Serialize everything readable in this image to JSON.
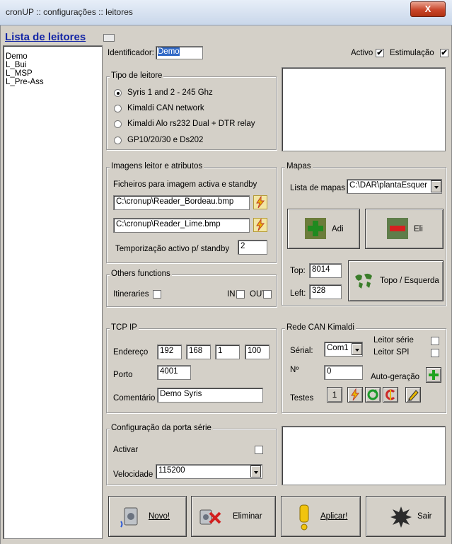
{
  "window": {
    "title": "cronUP :: configurações :: leitores",
    "close_label": "X"
  },
  "list": {
    "title": "Lista de leitores",
    "items": [
      "Demo",
      "L_Bui",
      "L_MSP",
      "L_Pre-Ass"
    ]
  },
  "identificador": {
    "label": "Identificador:",
    "value": "Demo"
  },
  "activo": {
    "label": "Activo",
    "checked": true
  },
  "estimulacao": {
    "label": "Estimulação",
    "checked": true
  },
  "tipo_leitor": {
    "title": "Tipo de leitore",
    "options": [
      "Syris 1 and 2 - 245 Ghz",
      "Kimaldi CAN network",
      "Kimaldi Alo rs232 Dual + DTR relay",
      "GP10/20/30 e Ds202"
    ],
    "selected_index": 0
  },
  "imagens": {
    "title": "Imagens leitor e atributos",
    "ficheiros_label": "Ficheiros para imagem activa e standby",
    "file_active": "C:\\cronup\\Reader_Bordeau.bmp",
    "file_standby": "C:\\cronup\\Reader_Lime.bmp",
    "temporizacao_label": "Temporização activo p/ standby",
    "temporizacao_value": "2"
  },
  "mapas": {
    "title": "Mapas",
    "lista_label": "Lista de mapas",
    "lista_value": "C:\\DAR\\plantaEsquer",
    "add_label": "Adi",
    "del_label": "Eli",
    "top_label": "Top:",
    "top_value": "8014",
    "left_label": "Left:",
    "left_value": "328",
    "topo_button": "Topo / Esquerda"
  },
  "others": {
    "title": "Others functions",
    "itineraries_label": "Itineraries",
    "in_label": "IN",
    "out_label": "OUT"
  },
  "tcpip": {
    "title": "TCP IP",
    "endereco_label": "Endereço",
    "ip": [
      "192",
      "168",
      "1",
      "100"
    ],
    "porto_label": "Porto",
    "porto_value": "4001",
    "comentario_label": "Comentário",
    "comentario_value": "Demo Syris"
  },
  "rede_can": {
    "title": "Rede CAN Kimaldi",
    "serial_label": "Sérial:",
    "serial_value": "Com1",
    "leitor_serie_label": "Leitor série",
    "leitor_spi_label": "Leitor SPI",
    "n_label": "Nº",
    "n_value": "0",
    "autogeracao_label": "Auto-geração",
    "testes_label": "Testes",
    "testes_number": "1"
  },
  "porta_serie": {
    "title": "Configuração da porta série",
    "activar_label": "Activar",
    "velocidade_label": "Velocidade",
    "velocidade_value": "115200"
  },
  "buttons": {
    "novo": "Novo!",
    "eliminar": "Eliminar",
    "aplicar": "Aplicar!",
    "sair": "Sair"
  }
}
